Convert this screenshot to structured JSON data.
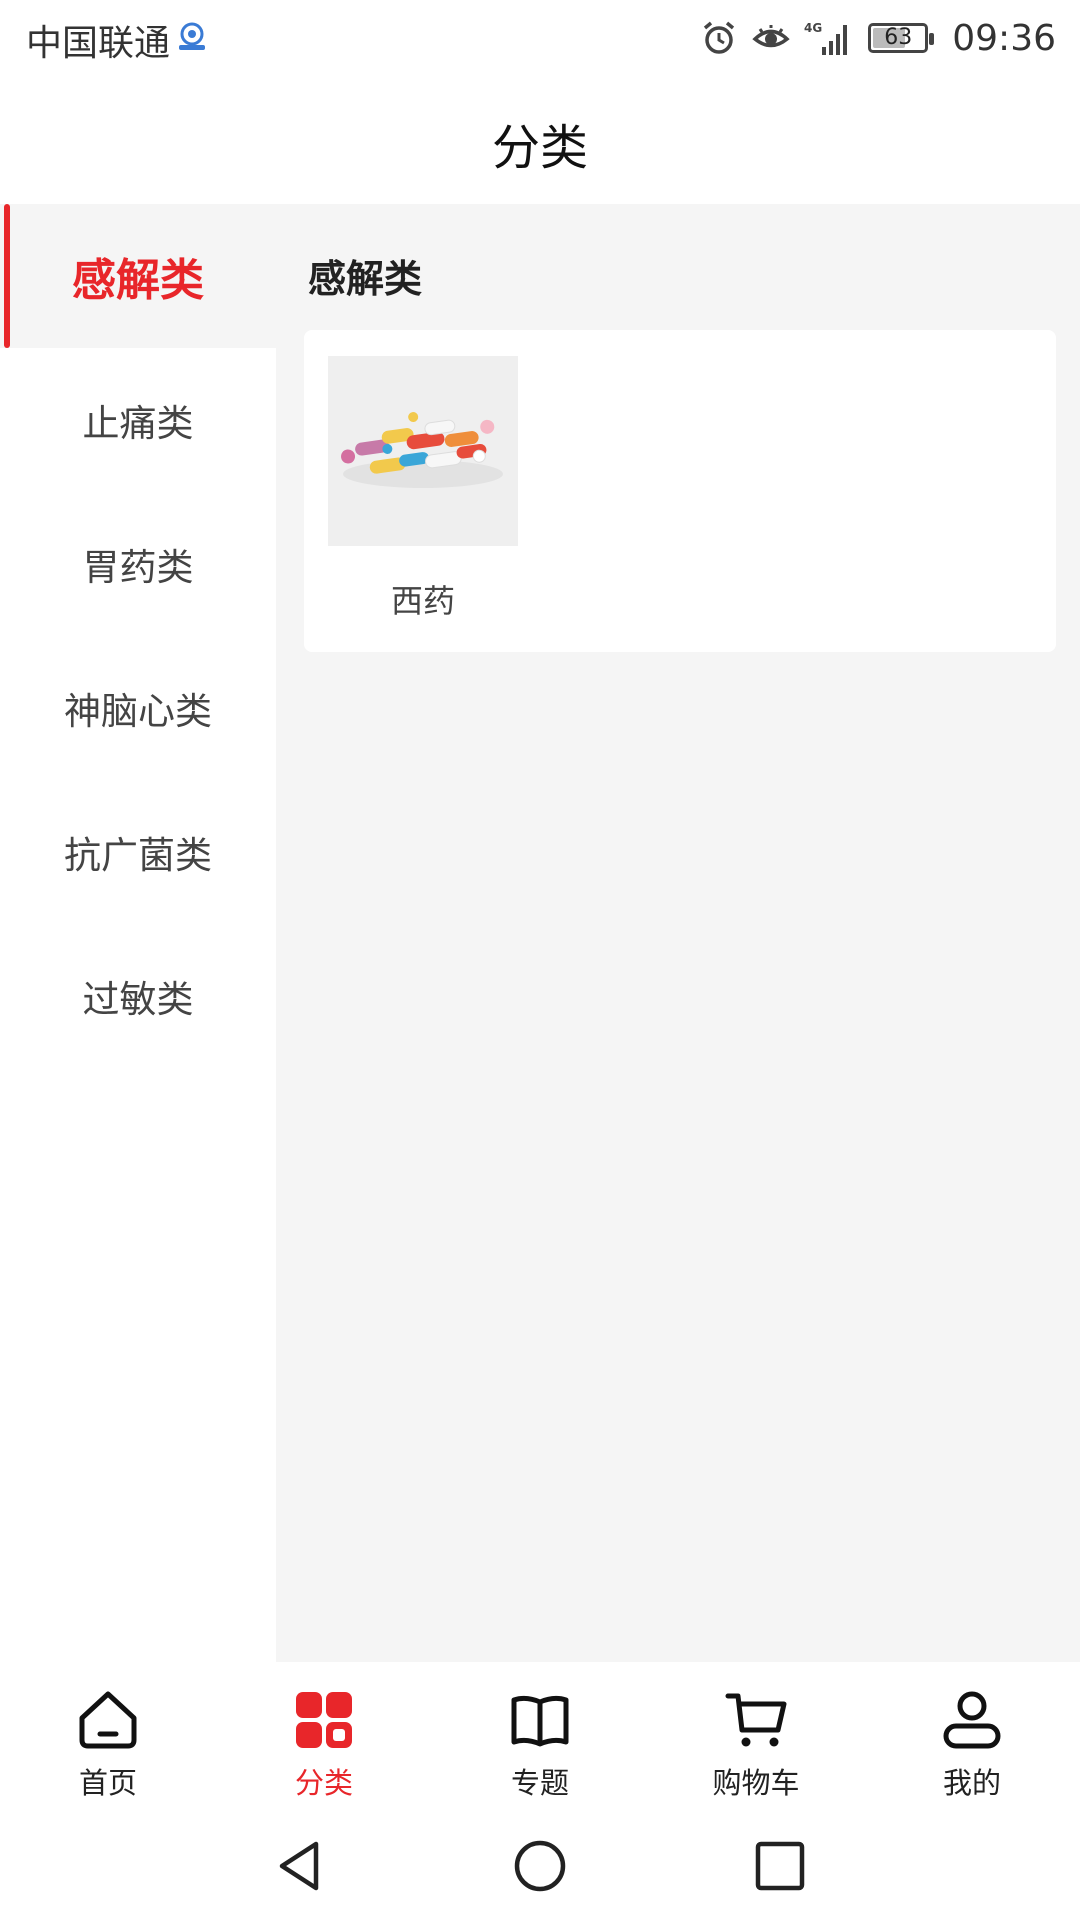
{
  "status_bar": {
    "carrier": "中国联通",
    "time": "09:36",
    "battery": "63",
    "battery_level": 0.63,
    "network": "4G",
    "icons": [
      "alarm-icon",
      "eye-comfort-icon",
      "signal-icon",
      "battery-icon"
    ]
  },
  "header": {
    "title": "分类"
  },
  "sidebar": {
    "items": [
      {
        "label": "感解类",
        "active": true
      },
      {
        "label": "止痛类",
        "active": false
      },
      {
        "label": "胃药类",
        "active": false
      },
      {
        "label": "神脑心类",
        "active": false
      },
      {
        "label": "抗广菌类",
        "active": false
      },
      {
        "label": "过敏类",
        "active": false
      }
    ]
  },
  "content": {
    "section_title": "感解类",
    "products": [
      {
        "name": "西药",
        "image": "pills-image"
      }
    ]
  },
  "bottom_nav": {
    "items": [
      {
        "label": "首页",
        "icon": "home-icon",
        "active": false
      },
      {
        "label": "分类",
        "icon": "category-grid-icon",
        "active": true
      },
      {
        "label": "专题",
        "icon": "book-icon",
        "active": false
      },
      {
        "label": "购物车",
        "icon": "cart-icon",
        "active": false
      },
      {
        "label": "我的",
        "icon": "profile-icon",
        "active": false
      }
    ]
  },
  "system_nav": {
    "icons": [
      "back-icon",
      "home-circle-icon",
      "recents-icon"
    ]
  },
  "colors": {
    "accent": "#e8262a",
    "background": "#f5f5f5",
    "text": "#222222"
  }
}
